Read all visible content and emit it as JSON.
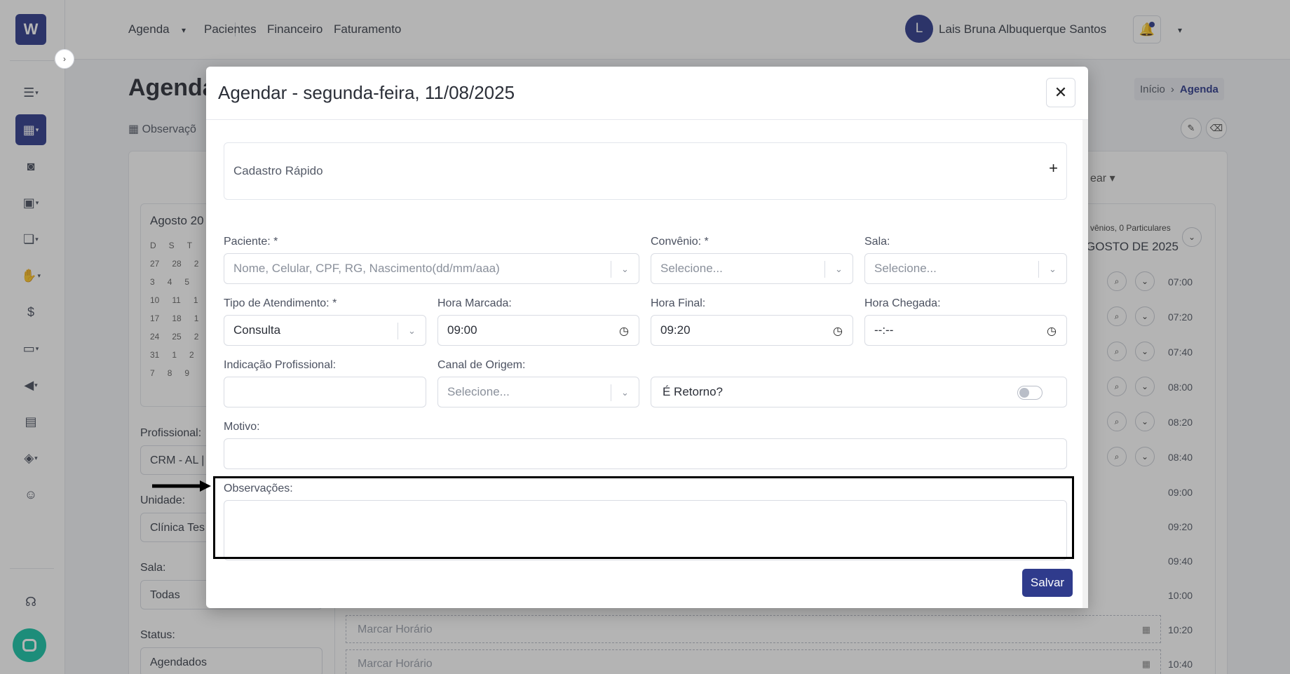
{
  "nav": {
    "agenda": "Agenda",
    "pacientes": "Pacientes",
    "financeiro": "Financeiro",
    "faturamento": "Faturamento",
    "user_initial": "L",
    "user_name": "Lais Bruna Albuquerque Santos"
  },
  "page": {
    "title": "Agenda",
    "obs_link": "Observaçõ",
    "breadcrumb_home": "Início",
    "breadcrumb_current": "Agenda",
    "toolbar_fragment": "ear"
  },
  "mini_calendar": {
    "title": "Agosto 20",
    "weekdays": [
      "D",
      "S",
      "T"
    ],
    "rows": [
      [
        "27",
        "28",
        "2"
      ],
      [
        "3",
        "4",
        "5"
      ],
      [
        "10",
        "11",
        "1"
      ],
      [
        "17",
        "18",
        "1"
      ],
      [
        "24",
        "25",
        "2"
      ],
      [
        "31",
        "1",
        "2"
      ],
      [
        "7",
        "8",
        "9"
      ]
    ]
  },
  "filters": {
    "profissional_label": "Profissional:",
    "profissional_value": "CRM - AL |",
    "unidade_label": "Unidade:",
    "unidade_value": "Clínica Tes",
    "sala_label": "Sala:",
    "sala_value": "Todas",
    "status_label": "Status:",
    "status_value": "Agendados"
  },
  "schedule": {
    "info": "vênios, 0 Particulares",
    "month": "GOSTO DE 2025",
    "times": [
      "07:00",
      "07:20",
      "07:40",
      "08:00",
      "08:20",
      "08:40",
      "09:00",
      "09:20",
      "09:40",
      "10:00",
      "10:20",
      "10:40"
    ],
    "slot_label": "Marcar Horário"
  },
  "modal": {
    "title": "Agendar - segunda-feira, 11/08/2025",
    "quick_register": "Cadastro Rápido",
    "paciente_label": "Paciente: *",
    "paciente_placeholder": "Nome, Celular, CPF, RG, Nascimento(dd/mm/aaa)",
    "convenio_label": "Convênio: *",
    "convenio_placeholder": "Selecione...",
    "sala_label": "Sala:",
    "sala_placeholder": "Selecione...",
    "tipo_label": "Tipo de Atendimento: *",
    "tipo_value": "Consulta",
    "hora_marcada_label": "Hora Marcada:",
    "hora_marcada_value": "09:00",
    "hora_final_label": "Hora Final:",
    "hora_final_value": "09:20",
    "hora_chegada_label": "Hora Chegada:",
    "hora_chegada_value": "--:--",
    "indicacao_label": "Indicação Profissional:",
    "canal_label": "Canal de Origem:",
    "canal_placeholder": "Selecione...",
    "retorno_label": "É Retorno?",
    "motivo_label": "Motivo:",
    "observacoes_label": "Observações:",
    "save_label": "Salvar"
  },
  "colors": {
    "primary": "#2f3b8c",
    "chat": "#18c3a6"
  }
}
